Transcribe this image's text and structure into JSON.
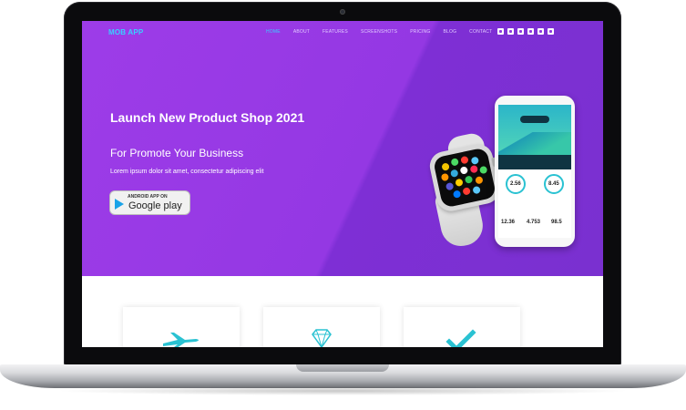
{
  "header": {
    "logo": "MOB APP",
    "nav": [
      "HOME",
      "ABOUT",
      "FEATURES",
      "SCREENSHOTS",
      "PRICING",
      "BLOG",
      "CONTACT"
    ],
    "social_icons": [
      "facebook-icon",
      "twitter-icon",
      "instagram-icon",
      "pinterest-icon",
      "youtube-icon",
      "skype-icon"
    ]
  },
  "hero": {
    "title": "Launch New Product Shop 2021",
    "subtitle": "For Promote Your Business",
    "description": "Lorem ipsum dolor sit amet, consectetur adipiscing elit",
    "store_badge": {
      "small": "ANDROID APP ON",
      "big": "Google play"
    }
  },
  "phone": {
    "stats": [
      "2.56",
      "8.45",
      "12.36",
      "4.753",
      "98.5"
    ]
  },
  "features": {
    "icons": [
      "airplane-icon",
      "diamond-icon",
      "checkmark-icon"
    ]
  },
  "colors": {
    "hero_purple": "#9438e3",
    "accent_cyan": "#38d0ff",
    "feature_icon": "#2ac2d2"
  }
}
